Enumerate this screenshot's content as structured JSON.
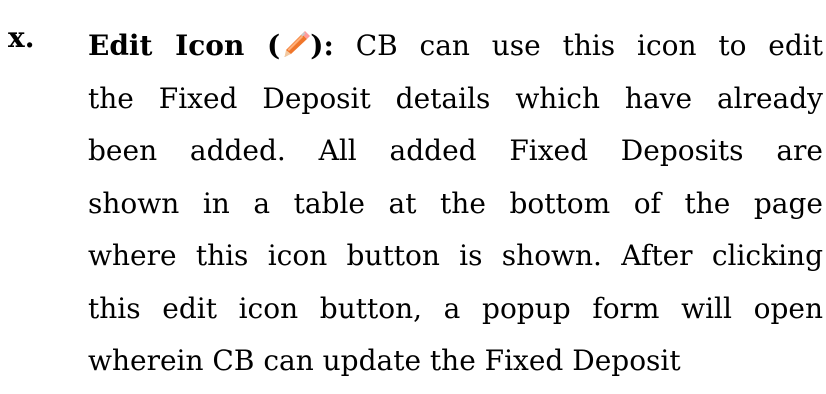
{
  "item": {
    "marker": "x.",
    "heading_prefix": "Edit Icon (",
    "heading_suffix": "):",
    "icon": "pencil-icon",
    "lines": [
      "CB can use this icon to edit",
      "the Fixed Deposit details which have already",
      "been added. All added Fixed Deposits are",
      "shown in a table at the bottom of the page",
      "where this icon button  is shown. After clicking",
      "this edit icon button, a popup form will open",
      "wherein CB can update the Fixed Deposit"
    ]
  }
}
